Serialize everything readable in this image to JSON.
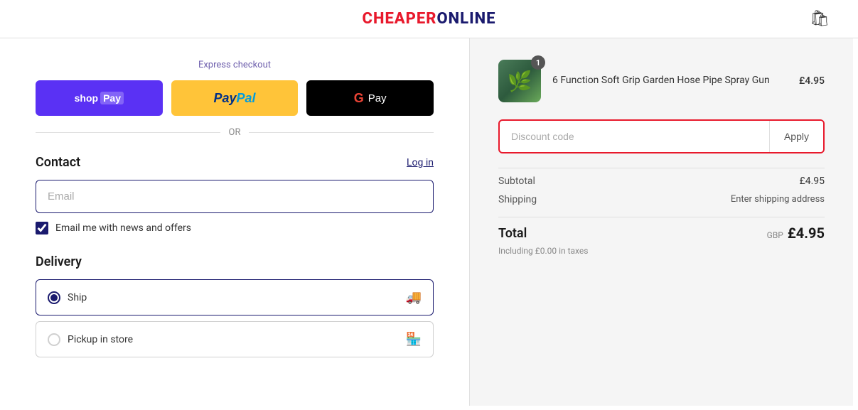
{
  "header": {
    "logo_cheaper": "CHEAPER",
    "logo_online": "ONLINE",
    "cart_icon": "🛍"
  },
  "left": {
    "express_checkout_label": "Express checkout",
    "shop_pay": {
      "shop": "shop",
      "pay": "Pay"
    },
    "paypal_label": "PayPal",
    "gpay_label": "G Pay",
    "or_label": "OR",
    "contact": {
      "title": "Contact",
      "login_label": "Log in",
      "email_placeholder": "Email",
      "newsletter_label": "Email me with news and offers"
    },
    "delivery": {
      "title": "Delivery",
      "options": [
        {
          "label": "Ship",
          "selected": true
        },
        {
          "label": "Pickup in store",
          "selected": false
        }
      ]
    }
  },
  "right": {
    "product": {
      "name": "6 Function Soft Grip Garden Hose Pipe Spray Gun",
      "price": "£4.95",
      "badge": "1"
    },
    "discount": {
      "placeholder": "Discount code",
      "apply_label": "Apply"
    },
    "subtotal_label": "Subtotal",
    "subtotal_value": "£4.95",
    "shipping_label": "Shipping",
    "shipping_value": "Enter shipping address",
    "total_label": "Total",
    "total_currency": "GBP",
    "total_amount": "£4.95",
    "tax_note": "Including £0.00 in taxes"
  }
}
